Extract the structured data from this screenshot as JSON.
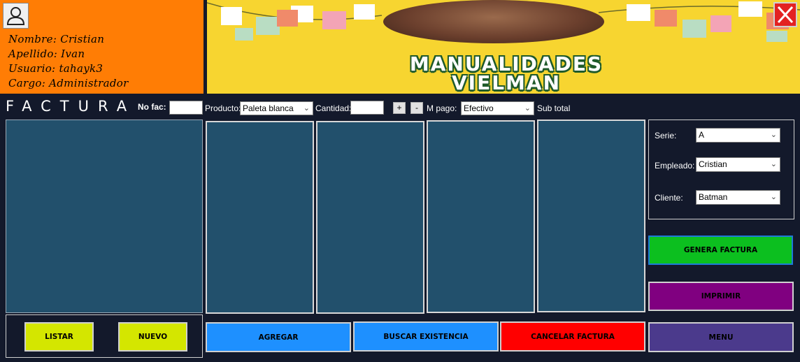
{
  "user": {
    "nombre": "Nombre:  Cristian",
    "apellido": "Apellido:  Ivan",
    "usuario": "Usuario:  tahayk3",
    "cargo": "Cargo: Administrador"
  },
  "banner": {
    "title_line1": "MANUALIDADES",
    "title_line2": "VIELMAN"
  },
  "form": {
    "title": "FACTURA",
    "nofac_label": "No fac:",
    "nofac_value": "",
    "producto_label": "Producto:",
    "producto_value": "Paleta blanca",
    "cantidad_label": "Cantidad:",
    "cantidad_value": "",
    "plus_label": "+",
    "minus_label": "-",
    "mpago_label": "M pago:",
    "mpago_value": "Efectivo",
    "subtotal_label": "Sub total"
  },
  "side": {
    "serie_label": "Serie:",
    "serie_value": "A",
    "empleado_label": "Empleado:",
    "empleado_value": "Cristian",
    "cliente_label": "Cliente:",
    "cliente_value": "Batman"
  },
  "buttons": {
    "genera": "GENERA FACTURA",
    "imprimir": "IMPRIMIR",
    "menu": "MENU",
    "listar": "LISTAR",
    "nuevo": "NUEVO",
    "agregar": "AGREGAR",
    "buscar": "BUSCAR EXISTENCIA",
    "cancelar": "CANCELAR FACTURA"
  },
  "colors": {
    "background": "#13192b",
    "user_panel": "#ff7d05",
    "banner": "#f7d530",
    "list": "#22506c",
    "genera": "#0cbf1f",
    "imprimir": "#800080",
    "menu": "#4b3a8c",
    "listar_nuevo": "#d4e600",
    "agregar_buscar": "#1e90ff",
    "cancelar": "#ff0000",
    "close": "#e32222"
  },
  "icons": {
    "avatar": "user-icon",
    "close": "close-icon",
    "dropdown": "chevron-down-icon"
  }
}
